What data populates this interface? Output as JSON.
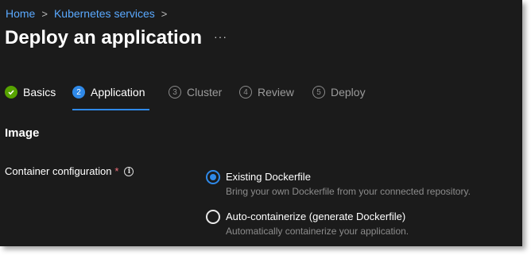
{
  "breadcrumb": {
    "items": [
      "Home",
      "Kubernetes services"
    ],
    "separator": ">"
  },
  "page": {
    "title": "Deploy an application",
    "more_label": "···"
  },
  "steps": [
    {
      "number": "✓",
      "label": "Basics",
      "state": "done"
    },
    {
      "number": "2",
      "label": "Application",
      "state": "active"
    },
    {
      "number": "3",
      "label": "Cluster",
      "state": "future"
    },
    {
      "number": "4",
      "label": "Review",
      "state": "future"
    },
    {
      "number": "5",
      "label": "Deploy",
      "state": "future"
    }
  ],
  "section": {
    "title": "Image",
    "field_label": "Container configuration",
    "required_mark": "*",
    "info_icon": "i"
  },
  "options": [
    {
      "title": "Existing Dockerfile",
      "description": "Bring your own Dockerfile from your connected repository.",
      "selected": true
    },
    {
      "title": "Auto-containerize (generate Dockerfile)",
      "description": "Automatically containerize your application.",
      "selected": false
    }
  ],
  "colors": {
    "background": "#1b1b1b",
    "accent": "#2f89e8",
    "link": "#5aa9ff",
    "success": "#57a300"
  }
}
